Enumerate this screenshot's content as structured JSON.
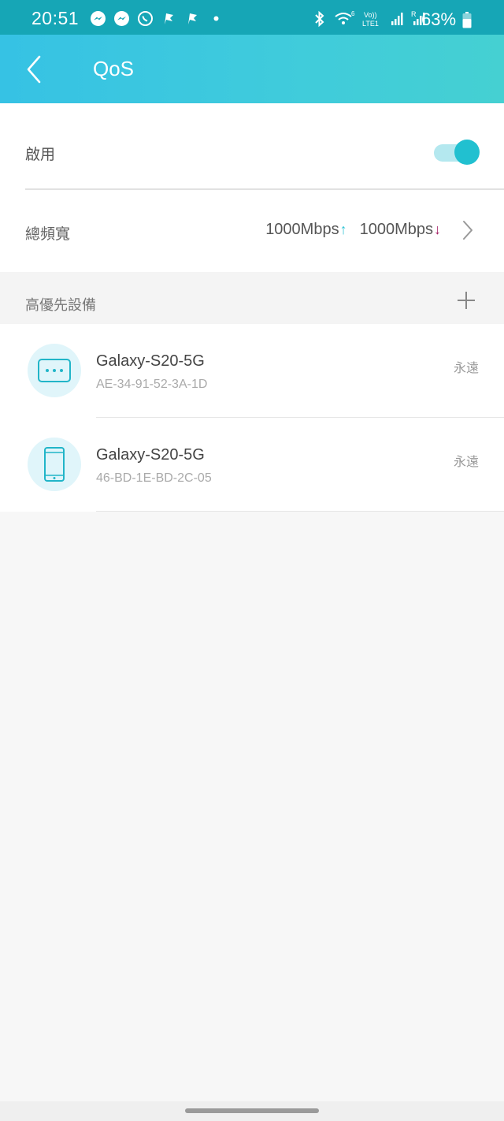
{
  "status_bar": {
    "time": "20:51",
    "battery": "63%",
    "notification_icons": [
      "messenger-icon",
      "messenger-icon",
      "whatsapp-icon",
      "flag-icon",
      "flag-icon",
      "dot-icon"
    ],
    "system_icons": [
      "bluetooth-icon",
      "wifi-icon",
      "volte-icon",
      "signal-icon",
      "signal-roaming-icon"
    ],
    "volte_label": "Vo))",
    "lte_label": "LTE1",
    "roaming_label": "R"
  },
  "header": {
    "title": "QoS",
    "back_icon": "chevron-left-icon",
    "color": "#3fcbdc"
  },
  "enable": {
    "label": "啟用",
    "toggle_on": true
  },
  "bandwidth": {
    "label": "總頻寬",
    "upload": "1000Mbps",
    "upload_arrow": "↑",
    "download": "1000Mbps",
    "download_arrow": "↓"
  },
  "priority": {
    "section_label": "高優先設備",
    "add_icon": "plus-icon"
  },
  "devices": [
    {
      "name": "Galaxy-S20-5G",
      "mac": "AE-34-91-52-3A-1D",
      "duration": "永遠",
      "icon": "other-device-icon"
    },
    {
      "name": "Galaxy-S20-5G",
      "mac": "46-BD-1E-BD-2C-05",
      "duration": "永遠",
      "icon": "phone-icon"
    }
  ],
  "colors": {
    "accent": "#21c0d0",
    "status_bar": "#16a6b6",
    "download_arrow": "#a0155e"
  }
}
